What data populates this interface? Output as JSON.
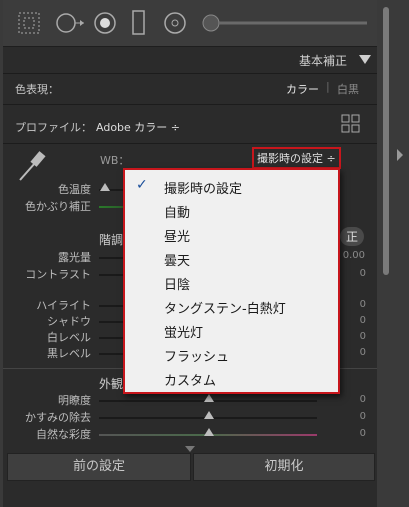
{
  "basic_panel": {
    "section_title": "基本補正",
    "color_mode_label": "色表現：",
    "color_option": "カラー",
    "bw_option": "白黒",
    "profile_label": "プロファイル：",
    "profile_value": "Adobe カラー ÷",
    "wb_label": "WB：",
    "wb_value": "撮影時の設定 ÷",
    "tone_label": "階調",
    "auto_label": "正",
    "exposure_value": "0.00",
    "presence_label": "外観"
  },
  "sliders": {
    "temperature": "色温度",
    "tint": "色かぶり補正",
    "exposure": "露光量",
    "contrast": "コントラスト",
    "contrast_value": "0",
    "highlights": "ハイライト",
    "highlights_value": "0",
    "shadows": "シャドウ",
    "shadows_value": "0",
    "whites": "白レベル",
    "whites_value": "0",
    "blacks": "黒レベル",
    "blacks_value": "0",
    "clarity": "明瞭度",
    "clarity_value": "0",
    "dehaze": "かすみの除去",
    "dehaze_value": "0",
    "vibrance": "自然な彩度",
    "vibrance_value": "0"
  },
  "wb_menu": {
    "items": [
      "撮影時の設定",
      "自動",
      "昼光",
      "曇天",
      "日陰",
      "タングステン-白熱灯",
      "蛍光灯",
      "フラッシュ",
      "カスタム"
    ],
    "checked": "撮影時の設定"
  },
  "buttons": {
    "previous": "前の設定",
    "reset": "初期化"
  },
  "colors": {
    "menu_border": "#c7161c",
    "panel_bg": "#2b2b2b"
  }
}
